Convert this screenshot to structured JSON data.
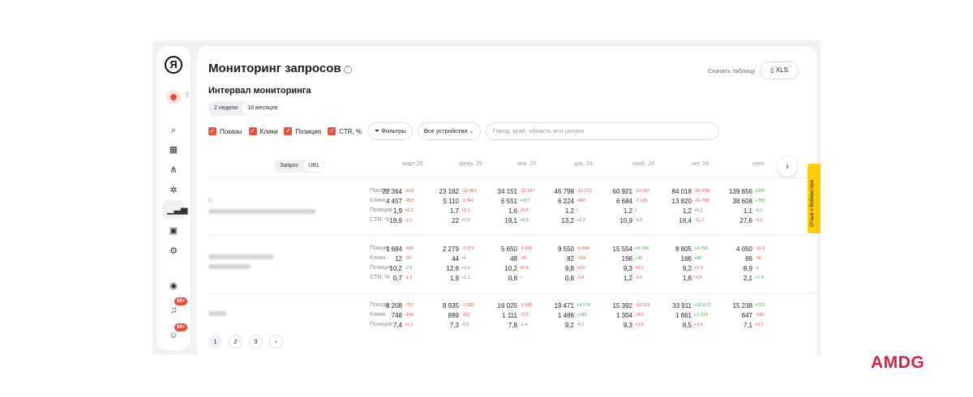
{
  "header": {
    "title": "Мониторинг запросов",
    "download_label": "Скачать таблицу",
    "xls_label": "XLS"
  },
  "interval": {
    "title": "Интервал мониторинга",
    "options": [
      "2 недели",
      "18 месяцев"
    ],
    "selected": "18 месяцев"
  },
  "filters": {
    "checkboxes": [
      "Показы",
      "Клики",
      "Позиция",
      "CTR, %"
    ],
    "filter_button": "Фильтры",
    "device_select": "Все устройства",
    "region_placeholder": "Город, край, область или регион"
  },
  "table": {
    "toggle": [
      "Запрос",
      "URL"
    ],
    "months": [
      "март 25",
      "февр. 25",
      "янв. 25",
      "дек. 24",
      "нояб. 24",
      "окт. 24",
      "сент."
    ],
    "metrics": [
      "Показы",
      "Клики",
      "Позиция",
      "CTR, %"
    ],
    "groups": [
      {
        "rows": [
          [
            [
              "22 364",
              "-818",
              "red"
            ],
            [
              "23 182",
              "-10 969",
              "red"
            ],
            [
              "34 151",
              "-12 647",
              "red"
            ],
            [
              "46 798",
              "-14 123",
              "red"
            ],
            [
              "60 921",
              "-23 097",
              "red"
            ],
            [
              "84 018",
              "-55 638",
              "red"
            ],
            [
              "139 656",
              "+295",
              "green"
            ]
          ],
          [
            [
              "4 457",
              "-653",
              "red"
            ],
            [
              "5 110",
              "-1 441",
              "red"
            ],
            [
              "6 551",
              "+327",
              "green"
            ],
            [
              "6 224",
              "-460",
              "red"
            ],
            [
              "6 684",
              "-7 136",
              "red"
            ],
            [
              "13 820",
              "-24 788",
              "red"
            ],
            [
              "38 608",
              "+789",
              "green"
            ]
          ],
          [
            [
              "1,9",
              "+0,2",
              "red"
            ],
            [
              "1,7",
              "+0,1",
              "red"
            ],
            [
              "1,6",
              "+0,4",
              "red"
            ],
            [
              "1,2",
              "0",
              "gray"
            ],
            [
              "1,2",
              "0",
              "gray"
            ],
            [
              "1,2",
              "+0,1",
              "red"
            ],
            [
              "1,1",
              "-0,1",
              "green"
            ]
          ],
          [
            [
              "19,9",
              "-2,1",
              "red"
            ],
            [
              "22",
              "+2,9",
              "green"
            ],
            [
              "19,1",
              "+5,9",
              "green"
            ],
            [
              "13,2",
              "+2,3",
              "green"
            ],
            [
              "10,9",
              "-5,5",
              "red"
            ],
            [
              "16,4",
              "-11,2",
              "red"
            ],
            [
              "27,6",
              "-0,3",
              "red"
            ]
          ]
        ]
      },
      {
        "rows": [
          [
            [
              "1 684",
              "-595",
              "red"
            ],
            [
              "2 279",
              "-3 371",
              "red"
            ],
            [
              "5 650",
              "-3 900",
              "red"
            ],
            [
              "9 550",
              "-6 004",
              "red"
            ],
            [
              "15 554",
              "+6 749",
              "green"
            ],
            [
              "8 805",
              "+4 755",
              "green"
            ],
            [
              "4 050",
              "-11 6",
              "red"
            ]
          ],
          [
            [
              "12",
              "-32",
              "red"
            ],
            [
              "44",
              "-4",
              "red"
            ],
            [
              "48",
              "-34",
              "red"
            ],
            [
              "82",
              "-114",
              "red"
            ],
            [
              "196",
              "+30",
              "green"
            ],
            [
              "166",
              "+80",
              "green"
            ],
            [
              "86",
              "-36",
              "red"
            ]
          ],
          [
            [
              "10,2",
              "-2,6",
              "green"
            ],
            [
              "12,8",
              "+2,6",
              "red"
            ],
            [
              "10,2",
              "+0,4",
              "red"
            ],
            [
              "9,8",
              "+0,5",
              "red"
            ],
            [
              "9,3",
              "+0,1",
              "red"
            ],
            [
              "9,2",
              "+0,3",
              "red"
            ],
            [
              "8,9",
              "-1",
              "green"
            ]
          ],
          [
            [
              "0,7",
              "-1,2",
              "red"
            ],
            [
              "1,9",
              "+1,1",
              "green"
            ],
            [
              "0,8",
              "0",
              "gray"
            ],
            [
              "0,8",
              "-0,4",
              "red"
            ],
            [
              "1,2",
              "-0,6",
              "red"
            ],
            [
              "1,8",
              "-0,3",
              "red"
            ],
            [
              "2,1",
              "+1,4",
              "green"
            ]
          ]
        ]
      },
      {
        "rows": [
          [
            [
              "8 208",
              "-727",
              "red"
            ],
            [
              "8 935",
              "-7 090",
              "red"
            ],
            [
              "16 025",
              "-3 446",
              "red"
            ],
            [
              "19 471",
              "+4 079",
              "green"
            ],
            [
              "15 392",
              "-18 519",
              "red"
            ],
            [
              "33 911",
              "+18 673",
              "green"
            ],
            [
              "15 238",
              "+212",
              "green"
            ]
          ],
          [
            [
              "748",
              "-141",
              "red"
            ],
            [
              "889",
              "-222",
              "red"
            ],
            [
              "1 111",
              "-375",
              "red"
            ],
            [
              "1 486",
              "+182",
              "green"
            ],
            [
              "1 304",
              "-357",
              "red"
            ],
            [
              "1 661",
              "+1 014",
              "green"
            ],
            [
              "647",
              "-439",
              "red"
            ]
          ],
          [
            [
              "7,4",
              "+0,1",
              "red"
            ],
            [
              "7,3",
              "-0,5",
              "green"
            ],
            [
              "7,8",
              "-1,4",
              "green"
            ],
            [
              "9,2",
              "-0,1",
              "green"
            ],
            [
              "9,3",
              "+0,8",
              "red"
            ],
            [
              "8,5",
              "+1,4",
              "red"
            ],
            [
              "7,1",
              "+0,1",
              "red"
            ]
          ]
        ]
      }
    ]
  },
  "pagination": [
    "1",
    "2",
    "3"
  ],
  "rail": {
    "badge1": "99+",
    "badge2": "99+"
  },
  "feedback": "Отзыв о Вебмастере",
  "brand": "AMDG",
  "colors": {
    "accent": "#e5533d",
    "positive": "#3ba64a",
    "feedback": "#ffcc00",
    "brand": "#d6223f"
  }
}
